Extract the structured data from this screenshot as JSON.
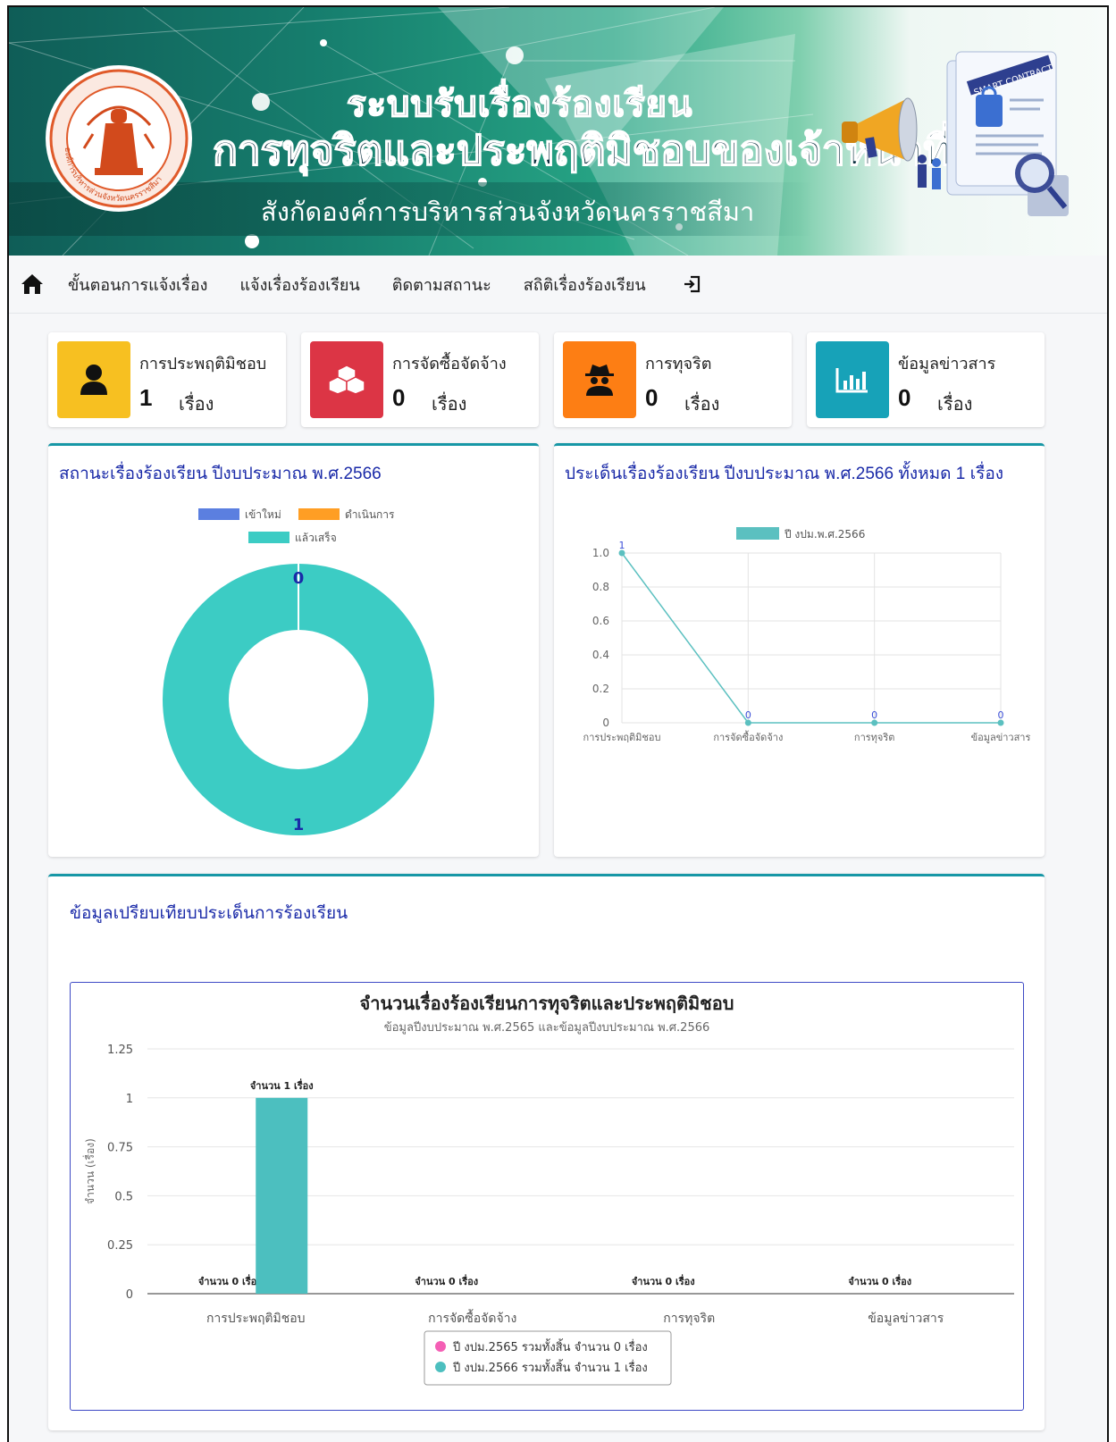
{
  "banner": {
    "title_line1": "ระบบรับเรื่องร้องเรียน",
    "title_line2": "การทุจริตและประพฤติมิชอบของเจ้าหน้าที่",
    "subtitle": "สังกัดองค์การบริหารส่วนจังหวัดนครราชสีมา",
    "seal_caption": "องค์การบริหารส่วนจังหวัดนครราชสีมา",
    "illustration_caption": "SMART CONTRACT"
  },
  "nav": {
    "home_icon": "home-icon",
    "items": [
      "ขั้นตอนการแจ้งเรื่อง",
      "แจ้งเรื่องร้องเรียน",
      "ติดตามสถานะ",
      "สถิติเรื่องร้องเรียน"
    ],
    "login_icon": "sign-in-icon"
  },
  "stats": [
    {
      "label": "การประพฤติมิชอบ",
      "count": "1",
      "unit": "เรื่อง",
      "icon": "user-icon",
      "color": "#f7c021"
    },
    {
      "label": "การจัดซื้อจัดจ้าง",
      "count": "0",
      "unit": "เรื่อง",
      "icon": "cubes-icon",
      "color": "#dc3545"
    },
    {
      "label": "การทุจริต",
      "count": "0",
      "unit": "เรื่อง",
      "icon": "user-secret-icon",
      "color": "#fd7e14"
    },
    {
      "label": "ข้อมูลข่าวสาร",
      "count": "0",
      "unit": "เรื่อง",
      "icon": "chart-bar-icon",
      "color": "#17a2b8"
    }
  ],
  "status_panel": {
    "title": "สถานะเรื่องร้องเรียน ปีงบประมาณ พ.ศ.2566"
  },
  "issue_panel": {
    "title": "ประเด็นเรื่องร้องเรียน ปีงบประมาณ พ.ศ.2566 ทั้งหมด 1 เรื่อง"
  },
  "compare_panel": {
    "title": "ข้อมูลเปรียบเทียบประเด็นการร้องเรียน"
  },
  "chart_data": [
    {
      "type": "pie",
      "style": "doughnut",
      "categories": [
        "เข้าใหม่",
        "ดำเนินการ",
        "แล้วเสร็จ"
      ],
      "values": [
        0,
        0,
        1
      ],
      "data_labels": [
        "0",
        "1"
      ],
      "colors": [
        "#5b7fe0",
        "#ff9e24",
        "#3cccc4"
      ],
      "legend_position": "top"
    },
    {
      "type": "line",
      "categories": [
        "การประพฤติมิชอบ",
        "การจัดซื้อจัดจ้าง",
        "การทุจริต",
        "ข้อมูลข่าวสาร"
      ],
      "series": [
        {
          "name": "ปี งปม.พ.ศ.2566",
          "values": [
            1,
            0,
            0,
            0
          ]
        }
      ],
      "ylim": [
        0,
        1
      ],
      "yticks": [
        "0",
        "0.2",
        "0.4",
        "0.6",
        "0.8",
        "1.0"
      ],
      "grid": true,
      "legend_position": "top",
      "colors": [
        "#5bc0c0"
      ]
    },
    {
      "type": "bar",
      "title": "จำนวนเรื่องร้องเรียนการทุจริตและประพฤติมิชอบ",
      "subtitle": "ข้อมูลปีงบประมาณ พ.ศ.2565 และข้อมูลปีงบประมาณ พ.ศ.2566",
      "ylabel": "จำนวน (เรื่อง)",
      "categories": [
        "การประพฤติมิชอบ",
        "การจัดซื้อจัดจ้าง",
        "การทุจริต",
        "ข้อมูลข่าวสาร"
      ],
      "series": [
        {
          "name": "ปี งปม.2565 รวมทั้งสิ้น จำนวน 0 เรื่อง",
          "values": [
            0,
            0,
            0,
            0
          ],
          "labels": [
            "จำนวน 0 เรื่อง",
            "จำนวน 0 เรื่อง",
            "จำนวน 0 เรื่อง",
            "จำนวน 0 เรื่อง"
          ]
        },
        {
          "name": "ปี งปม.2566 รวมทั้งสิ้น จำนวน 1 เรื่อง",
          "values": [
            1,
            0,
            0,
            0
          ],
          "labels": [
            "จำนวน 1 เรื่อง",
            "",
            "",
            ""
          ]
        }
      ],
      "ylim": [
        0,
        1.25
      ],
      "yticks": [
        "0",
        "0.25",
        "0.5",
        "0.75",
        "1",
        "1.25"
      ],
      "grid": true,
      "legend_position": "bottom",
      "colors": [
        "#f45fb5",
        "#4cbfbf"
      ]
    }
  ]
}
